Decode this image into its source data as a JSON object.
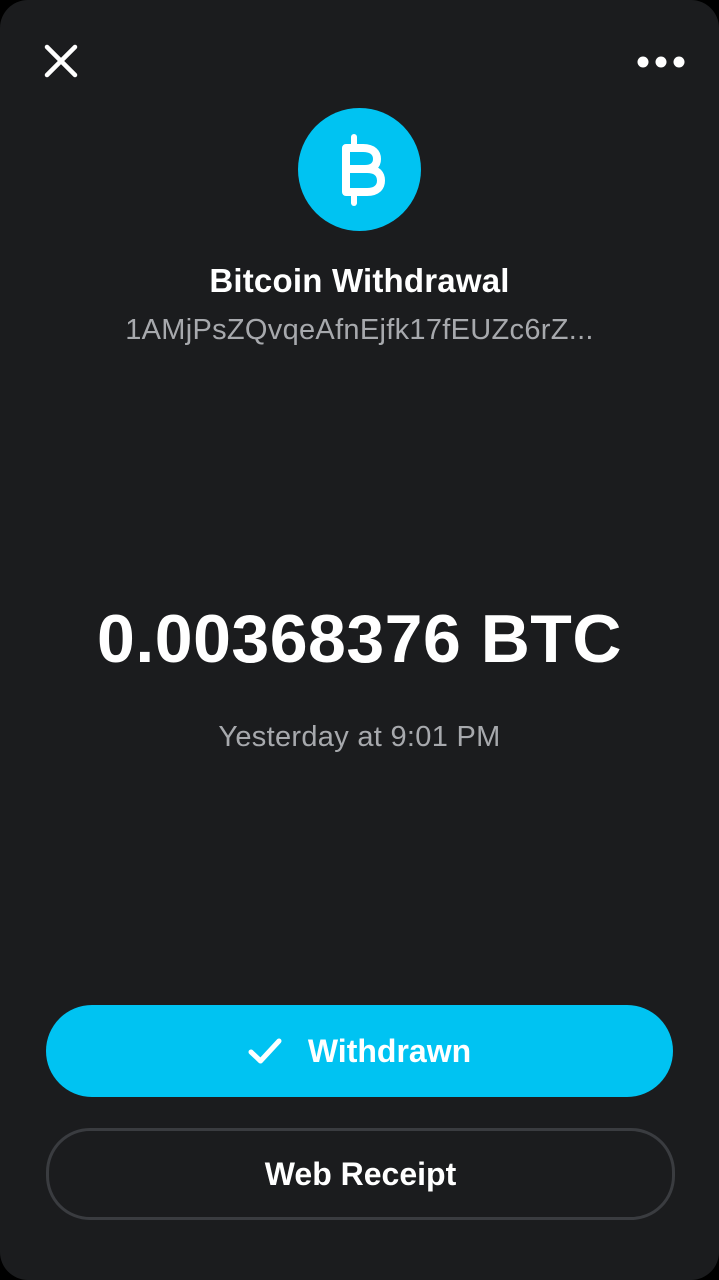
{
  "header": {
    "close_icon": "close-icon",
    "more_icon": "more-horizontal-icon"
  },
  "transaction": {
    "icon": "bitcoin-icon",
    "title": "Bitcoin Withdrawal",
    "address": "1AMjPsZQvqeAfnEjfk17fEUZc6rZ...",
    "amount": "0.00368376 BTC",
    "date": "Yesterday at 9:01 PM"
  },
  "actions": {
    "status_label": "Withdrawn",
    "status_icon": "checkmark-icon",
    "receipt_label": "Web Receipt"
  },
  "colors": {
    "background": "#1b1c1e",
    "accent": "#00c3f2",
    "secondary_text": "#a7a9ad",
    "outline": "#3a3c40"
  }
}
